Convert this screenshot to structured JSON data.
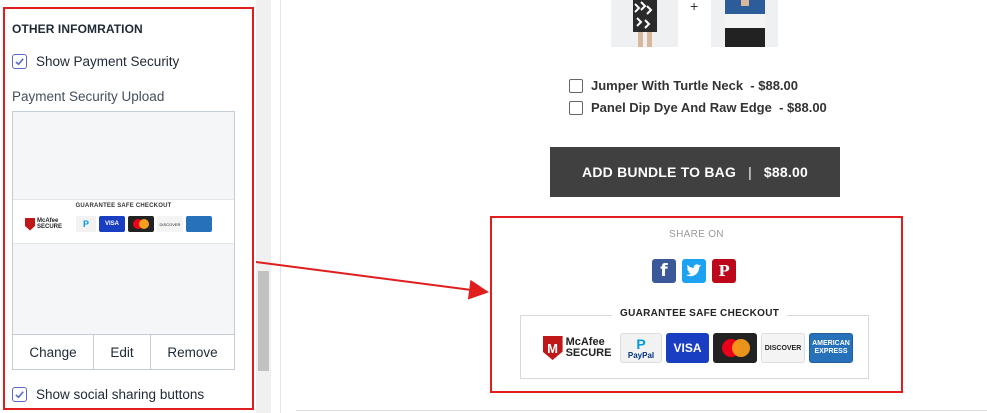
{
  "left_panel": {
    "section_title": "OTHER INFOMRATION",
    "show_payment_security": {
      "label": "Show Payment Security",
      "checked": true
    },
    "upload_label": "Payment Security Upload",
    "preview_caption": "GUARANTEE SAFE CHECKOUT",
    "buttons": {
      "change": "Change",
      "edit": "Edit",
      "remove": "Remove"
    },
    "show_social_sharing": {
      "label": "Show social sharing buttons",
      "checked": true
    }
  },
  "preview": {
    "plus": "+",
    "bundle_items": [
      {
        "name": "Jumper With Turtle Neck",
        "price": "- $88.00"
      },
      {
        "name": "Panel Dip Dye And Raw Edge",
        "price": "- $88.00"
      }
    ],
    "bundle_button": {
      "label": "ADD BUNDLE TO BAG",
      "separator": "|",
      "price": "$88.00"
    },
    "share_on": "SHARE ON",
    "share_icons": [
      {
        "name": "facebook-icon",
        "glyph": "f"
      },
      {
        "name": "twitter-icon",
        "glyph": "t"
      },
      {
        "name": "pinterest-icon",
        "glyph": "P"
      }
    ],
    "guarantee_label": "GUARANTEE SAFE CHECKOUT",
    "badges": {
      "mcafee_top": "McAfee",
      "mcafee_bottom": "SECURE",
      "paypal": "PayPal",
      "visa": "VISA",
      "discover": "DISCOVER",
      "amex_top": "AMERICAN",
      "amex_bottom": "EXPRESS"
    }
  },
  "colors": {
    "highlight_red": "#e01e1e",
    "checkbox_accent": "#5c6ac4",
    "bundle_button_bg": "#404040"
  }
}
